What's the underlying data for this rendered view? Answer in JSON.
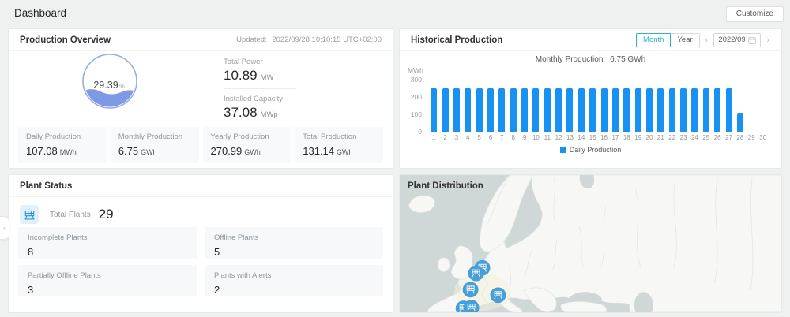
{
  "header": {
    "title": "Dashboard",
    "customize_label": "Customize"
  },
  "production_overview": {
    "title": "Production Overview",
    "updated_label": "Updated:",
    "updated_value": "2022/09/28 10:10:15 UTC+02:00",
    "gauge_value": "29.39",
    "gauge_unit": "%",
    "total_power_label": "Total Power",
    "total_power_value": "10.89",
    "total_power_unit": "MW",
    "installed_capacity_label": "Installed Capacity",
    "installed_capacity_value": "37.08",
    "installed_capacity_unit": "MWp",
    "stats": [
      {
        "label": "Daily Production",
        "value": "107.08",
        "unit": "MWh"
      },
      {
        "label": "Monthly Production",
        "value": "6.75",
        "unit": "GWh"
      },
      {
        "label": "Yearly Production",
        "value": "270.99",
        "unit": "GWh"
      },
      {
        "label": "Total Production",
        "value": "131.14",
        "unit": "GWh"
      }
    ]
  },
  "historical_production": {
    "title": "Historical Production",
    "toggle": {
      "month_label": "Month",
      "year_label": "Year",
      "selected": "Month"
    },
    "date_value": "2022/09",
    "subtitle_label": "Monthly Production:",
    "subtitle_value": "6.75 GWh",
    "legend_label": "Daily Production"
  },
  "chart_data": {
    "type": "bar",
    "title": "Monthly Production: 6.75 GWh",
    "ylabel": "MWh",
    "ylim": [
      0,
      300
    ],
    "yticks": [
      300,
      200,
      100,
      0
    ],
    "x": [
      1,
      2,
      3,
      4,
      5,
      6,
      7,
      8,
      9,
      10,
      11,
      12,
      13,
      14,
      15,
      16,
      17,
      18,
      19,
      20,
      21,
      22,
      23,
      24,
      25,
      26,
      27,
      28,
      29,
      30
    ],
    "series": [
      {
        "name": "Daily Production",
        "color": "#1791f2",
        "values": [
          250,
          250,
          250,
          250,
          250,
          250,
          250,
          250,
          250,
          250,
          250,
          250,
          250,
          250,
          250,
          250,
          250,
          250,
          250,
          250,
          250,
          250,
          250,
          250,
          250,
          250,
          250,
          107,
          0,
          0
        ]
      }
    ],
    "legend_position": "bottom",
    "grid": false
  },
  "plant_status": {
    "title": "Plant Status",
    "total_label": "Total Plants",
    "total_value": "29",
    "cards": [
      {
        "label": "Incomplete Plants",
        "value": "8"
      },
      {
        "label": "Offline Plants",
        "value": "5"
      },
      {
        "label": "Partially Offline Plants",
        "value": "3"
      },
      {
        "label": "Plants with Alerts",
        "value": "2"
      }
    ]
  },
  "plant_distribution": {
    "title": "Plant Distribution",
    "marker_icon": "solar-plant-icon",
    "markers": [
      {
        "x": 105,
        "y": 119
      },
      {
        "x": 97,
        "y": 126
      },
      {
        "x": 90,
        "y": 147
      },
      {
        "x": 125,
        "y": 154
      },
      {
        "x": 81,
        "y": 171
      },
      {
        "x": 91,
        "y": 170
      }
    ]
  },
  "colors": {
    "accent_blue": "#1791f2",
    "toggle_teal": "#2fb3c6",
    "gauge_blue": "#7e9ae4",
    "marker_blue": "#469fd7",
    "sea": "#cfd8d6",
    "land": "#f7f8f5"
  }
}
